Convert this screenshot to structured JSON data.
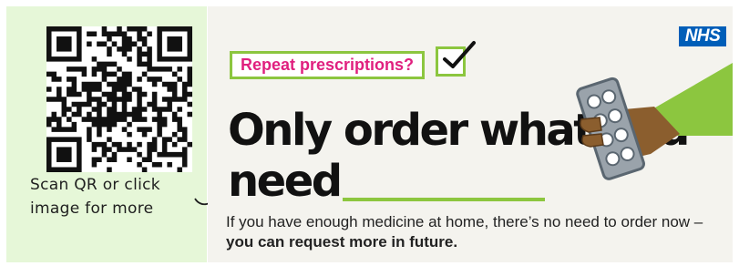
{
  "qr": {
    "icon": "qr-code-icon"
  },
  "scan_prompt": {
    "line1": "Scan  QR  or  click",
    "line2": "image  for more"
  },
  "banner": {
    "logo": "NHS",
    "tag": "Repeat prescriptions?",
    "headline_line1": "Only order",
    "headline_what": "what",
    "headline_you_need": "you need",
    "body_plain": "If you have enough medicine at home, there’s no need to order now – ",
    "body_bold": "you can request more in future."
  },
  "colors": {
    "green": "#8cc63f",
    "pink": "#e0207f",
    "nhs_blue": "#005eb8",
    "panel_bg": "#e6f7d8",
    "banner_bg": "#f4f3ee"
  }
}
